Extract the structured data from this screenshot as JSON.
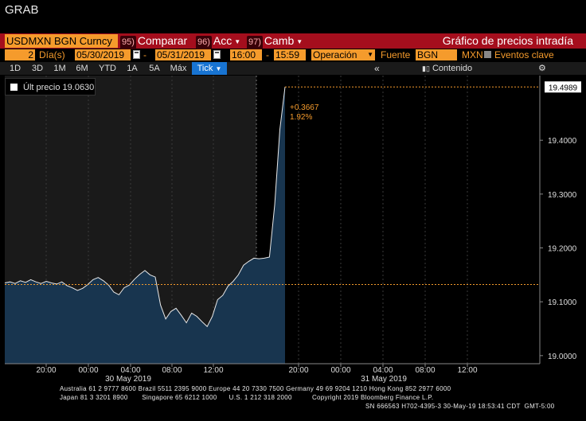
{
  "title": "GRAB",
  "toolbar": {
    "security": "USDMXN BGN Curncy",
    "compare": {
      "num": "95)",
      "label": "Comparar"
    },
    "actions": {
      "num": "96)",
      "label": "Acc"
    },
    "change": {
      "num": "97)",
      "label": "Camb"
    },
    "chart_title": "Gráfico de precios intradía"
  },
  "options": {
    "days_value": "2",
    "days_label": "Día(s)",
    "start_date": "05/30/2019",
    "end_date": "05/31/2019",
    "start_time": "16:00",
    "end_time": "15:59",
    "operation": "Operación",
    "source_label": "Fuente",
    "source_value": "BGN",
    "currency": "MXN",
    "key_events": "Eventos clave"
  },
  "periods": [
    "1D",
    "3D",
    "1M",
    "6M",
    "YTD",
    "1A",
    "5A",
    "Máx"
  ],
  "period_active": "Tick",
  "content_label": "Contenido",
  "legend": {
    "label": "Últ precio",
    "value": "19.0630"
  },
  "annotation": {
    "change": "+0.3667",
    "pct": "1.92%"
  },
  "last_price_tag": "19.4989",
  "chart_data": {
    "type": "area",
    "ylim": [
      18.985,
      19.52
    ],
    "yticks": [
      19.0,
      19.1,
      19.2,
      19.3,
      19.4
    ],
    "ytick_labels": [
      "19.0000",
      "19.1000",
      "19.2000",
      "19.3000",
      "19.4000"
    ],
    "xlabels": [
      "20:00",
      "00:00",
      "04:00",
      "08:00",
      "12:00",
      "20:00",
      "00:00",
      "04:00",
      "08:00",
      "12:00"
    ],
    "day_labels": [
      "30 May 2019",
      "31 May 2019"
    ],
    "reference_levels": [
      19.132,
      19.4989
    ],
    "series": [
      {
        "values": [
          19.135,
          19.137,
          19.134,
          19.139,
          19.136,
          19.141,
          19.137,
          19.134,
          19.138,
          19.135,
          19.133,
          19.137,
          19.13,
          19.126,
          19.121,
          19.125,
          19.132,
          19.141,
          19.145,
          19.139,
          19.131,
          19.118,
          19.113,
          19.126,
          19.131,
          19.142,
          19.151,
          19.158,
          19.15,
          19.146,
          19.094,
          19.068,
          19.082,
          19.088,
          19.075,
          19.061,
          19.079,
          19.073,
          19.063,
          19.054,
          19.073,
          19.104,
          19.112,
          19.129,
          19.138,
          19.15,
          19.168,
          19.175,
          19.181,
          19.18,
          19.181,
          19.183,
          19.28,
          19.42,
          19.499
        ]
      }
    ]
  }
}
